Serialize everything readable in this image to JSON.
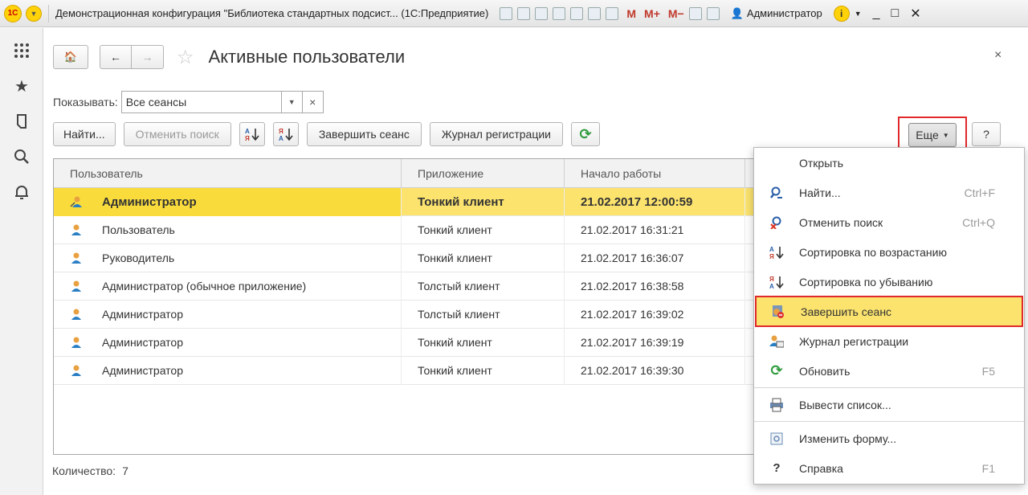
{
  "window": {
    "logo": "1С",
    "title": "Демонстрационная конфигурация \"Библиотека стандартных подсист... (1С:Предприятие)",
    "m_labels": [
      "M",
      "M+",
      "M−"
    ],
    "user": "Администратор",
    "controls": [
      "_",
      "□",
      "✕"
    ]
  },
  "sidebar": {
    "icons": [
      "apps-grid-icon",
      "star-icon",
      "history-icon",
      "search-icon",
      "bell-icon"
    ]
  },
  "form": {
    "title": "Активные пользователи",
    "close": "×",
    "home_glyph": "🏠",
    "back_glyph": "←",
    "forward_glyph": "→",
    "star_glyph": "☆"
  },
  "filter": {
    "label": "Показывать:",
    "value": "Все сеансы"
  },
  "commands": {
    "find": "Найти...",
    "cancel_search": "Отменить поиск",
    "end_session": "Завершить сеанс",
    "event_log": "Журнал регистрации",
    "more": "Еще",
    "help": "?"
  },
  "table": {
    "columns": [
      "Пользователь",
      "Приложение",
      "Начало работы"
    ],
    "rows": [
      {
        "user": "Администратор",
        "app": "Тонкий клиент",
        "start": "21.02.2017 12:00:59"
      },
      {
        "user": "Пользователь",
        "app": "Тонкий клиент",
        "start": "21.02.2017 16:31:21"
      },
      {
        "user": "Руководитель",
        "app": "Тонкий клиент",
        "start": "21.02.2017 16:36:07"
      },
      {
        "user": "Администратор (обычное приложение)",
        "app": "Толстый клиент",
        "start": "21.02.2017 16:38:58"
      },
      {
        "user": "Администратор",
        "app": "Толстый клиент",
        "start": "21.02.2017 16:39:02"
      },
      {
        "user": "Администратор",
        "app": "Тонкий клиент",
        "start": "21.02.2017 16:39:19"
      },
      {
        "user": "Администратор",
        "app": "Тонкий клиент",
        "start": "21.02.2017 16:39:30"
      }
    ]
  },
  "footer": {
    "count_label": "Количество:",
    "count_value": "7"
  },
  "menu": {
    "items": [
      {
        "label": "Открыть",
        "shortcut": "",
        "icon": ""
      },
      {
        "label": "Найти...",
        "shortcut": "Ctrl+F",
        "icon": "search-icon"
      },
      {
        "label": "Отменить поиск",
        "shortcut": "Ctrl+Q",
        "icon": "cancel-search-icon"
      },
      {
        "label": "Сортировка по возрастанию",
        "shortcut": "",
        "icon": "sort-asc-icon"
      },
      {
        "label": "Сортировка по убыванию",
        "shortcut": "",
        "icon": "sort-desc-icon"
      },
      {
        "label": "Завершить сеанс",
        "shortcut": "",
        "icon": "end-session-icon"
      },
      {
        "label": "Журнал регистрации",
        "shortcut": "",
        "icon": "event-log-icon"
      },
      {
        "label": "Обновить",
        "shortcut": "F5",
        "icon": "refresh-icon"
      },
      {
        "label": "Вывести список...",
        "shortcut": "",
        "icon": "print-list-icon"
      },
      {
        "label": "Изменить форму...",
        "shortcut": "",
        "icon": "edit-form-icon"
      },
      {
        "label": "Справка",
        "shortcut": "F1",
        "icon": "help-icon"
      }
    ]
  },
  "colors": {
    "highlight": "#fbe36e",
    "current_row_cell": "#f9dc3c",
    "callout_border": "#e0292b",
    "refresh_green": "#2e9b3b",
    "brand_yellow": "#ffd20a"
  }
}
